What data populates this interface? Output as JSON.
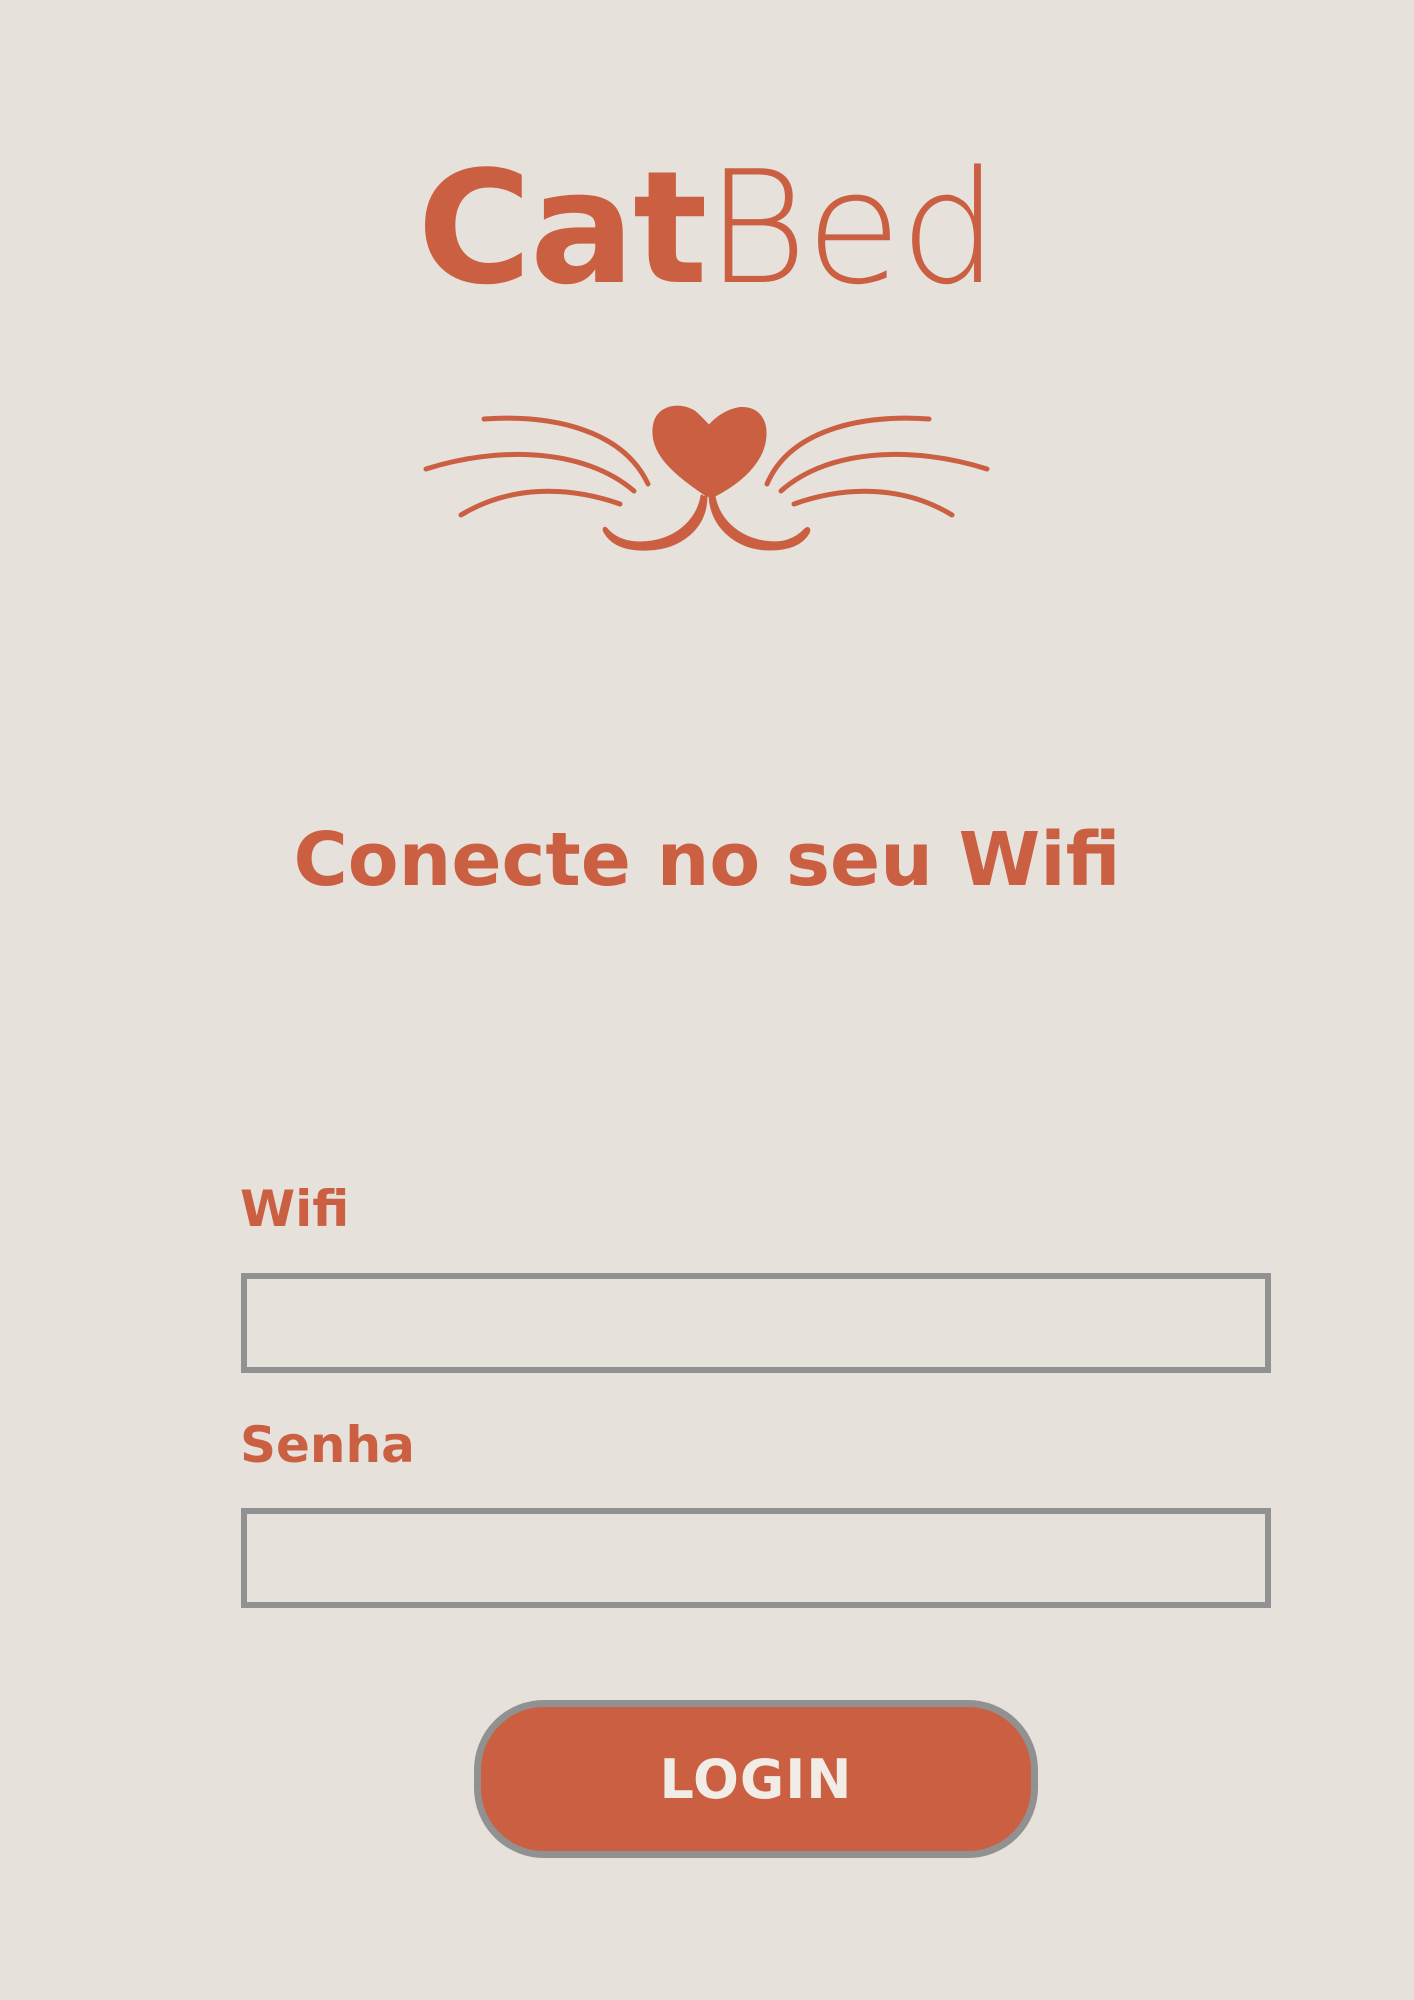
{
  "brand": {
    "name_strong": "Cat",
    "name_light": "Bed",
    "accent_color": "#cb5f42",
    "background_color": "#e6e1db",
    "mascot_icon": "cat-whiskers-nose-icon"
  },
  "page": {
    "heading": "Conecte no seu Wifi"
  },
  "form": {
    "wifi_label": "Wifi",
    "wifi_value": "",
    "wifi_placeholder": "",
    "password_label": "Senha",
    "password_value": "",
    "password_placeholder": "",
    "submit_label": "LOGIN"
  }
}
